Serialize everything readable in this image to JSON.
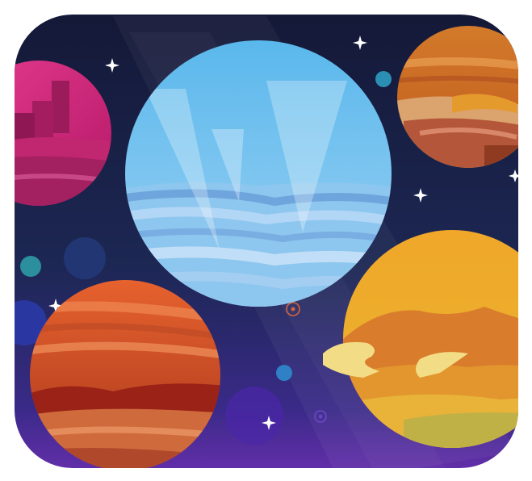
{
  "artwork": {
    "subject": "space-planets-app-icon",
    "palette": {
      "space_top": "#161a3c",
      "space_mid": "#1f2a58",
      "space_bottom": "#5a2aa8",
      "planet_pink": "#d9287e",
      "planet_blue": "#6cc2ef",
      "planet_rust": "#c6471f",
      "planet_gold": "#eeb02e",
      "planet_orange": "#d6782b",
      "star": "#ffffff"
    },
    "objects": [
      {
        "name": "pink-planet-icon"
      },
      {
        "name": "blue-ice-planet-icon"
      },
      {
        "name": "orange-banded-planet-icon"
      },
      {
        "name": "rust-planet-icon"
      },
      {
        "name": "golden-planet-icon"
      }
    ]
  }
}
